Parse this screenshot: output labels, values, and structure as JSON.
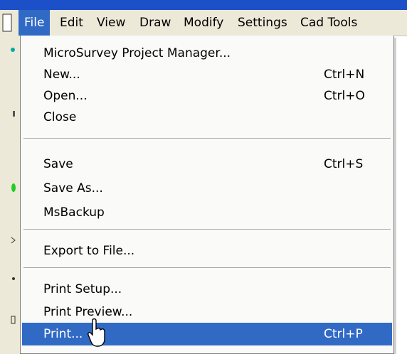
{
  "menubar": {
    "items": [
      {
        "label": "File",
        "active": true
      },
      {
        "label": "Edit",
        "active": false
      },
      {
        "label": "View",
        "active": false
      },
      {
        "label": "Draw",
        "active": false
      },
      {
        "label": "Modify",
        "active": false
      },
      {
        "label": "Settings",
        "active": false
      },
      {
        "label": "Cad Tools",
        "active": false
      }
    ]
  },
  "file_menu": {
    "groups": [
      [
        {
          "label": "MicroSurvey Project Manager...",
          "shortcut": ""
        },
        {
          "label": "New...",
          "shortcut": "Ctrl+N"
        },
        {
          "label": "Open...",
          "shortcut": "Ctrl+O"
        },
        {
          "label": "Close",
          "shortcut": ""
        }
      ],
      [
        {
          "label": "Save",
          "shortcut": "Ctrl+S"
        },
        {
          "label": "Save As...",
          "shortcut": ""
        },
        {
          "label": "MsBackup",
          "shortcut": ""
        }
      ],
      [
        {
          "label": "Export to File...",
          "shortcut": ""
        }
      ],
      [
        {
          "label": "Print Setup...",
          "shortcut": ""
        },
        {
          "label": "Print Preview...",
          "shortcut": ""
        },
        {
          "label": "Print...",
          "shortcut": "Ctrl+P",
          "highlighted": true
        }
      ]
    ]
  },
  "colors": {
    "highlight": "#316ac5",
    "menu_bg": "#ece9d8",
    "title_blue": "#1c50c8"
  }
}
